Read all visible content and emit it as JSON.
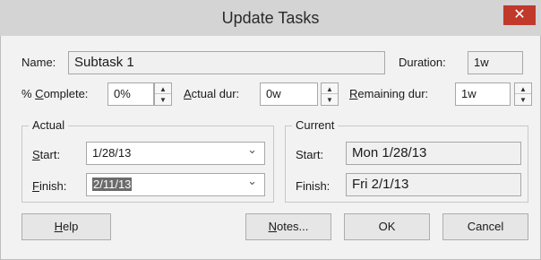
{
  "dialog": {
    "title": "Update Tasks",
    "close_glyph": "✕"
  },
  "name": {
    "label": "Name:",
    "value": "Subtask 1"
  },
  "duration": {
    "label": "Duration:",
    "value": "1w"
  },
  "percent_complete": {
    "label": "% Complete:",
    "value": "0%"
  },
  "actual_dur": {
    "label": "Actual dur:",
    "value": "0w"
  },
  "remaining_dur": {
    "label": "Remaining dur:",
    "value": "1w"
  },
  "actual_group": {
    "legend": "Actual",
    "start_label": "Start:",
    "start_value": "1/28/13",
    "finish_label": "Finish:",
    "finish_value": "2/11/13"
  },
  "current_group": {
    "legend": "Current",
    "start_label": "Start:",
    "start_value": "Mon 1/28/13",
    "finish_label": "Finish:",
    "finish_value": "Fri 2/1/13"
  },
  "buttons": {
    "help": "Help",
    "notes": "Notes...",
    "ok": "OK",
    "cancel": "Cancel"
  },
  "icons": {
    "spin_up": "▲",
    "spin_down": "▼",
    "dropdown": "⌄"
  },
  "colors": {
    "title_bar": "#d4d4d4",
    "close_button": "#c1392b",
    "selection": "#6b6b6b"
  }
}
